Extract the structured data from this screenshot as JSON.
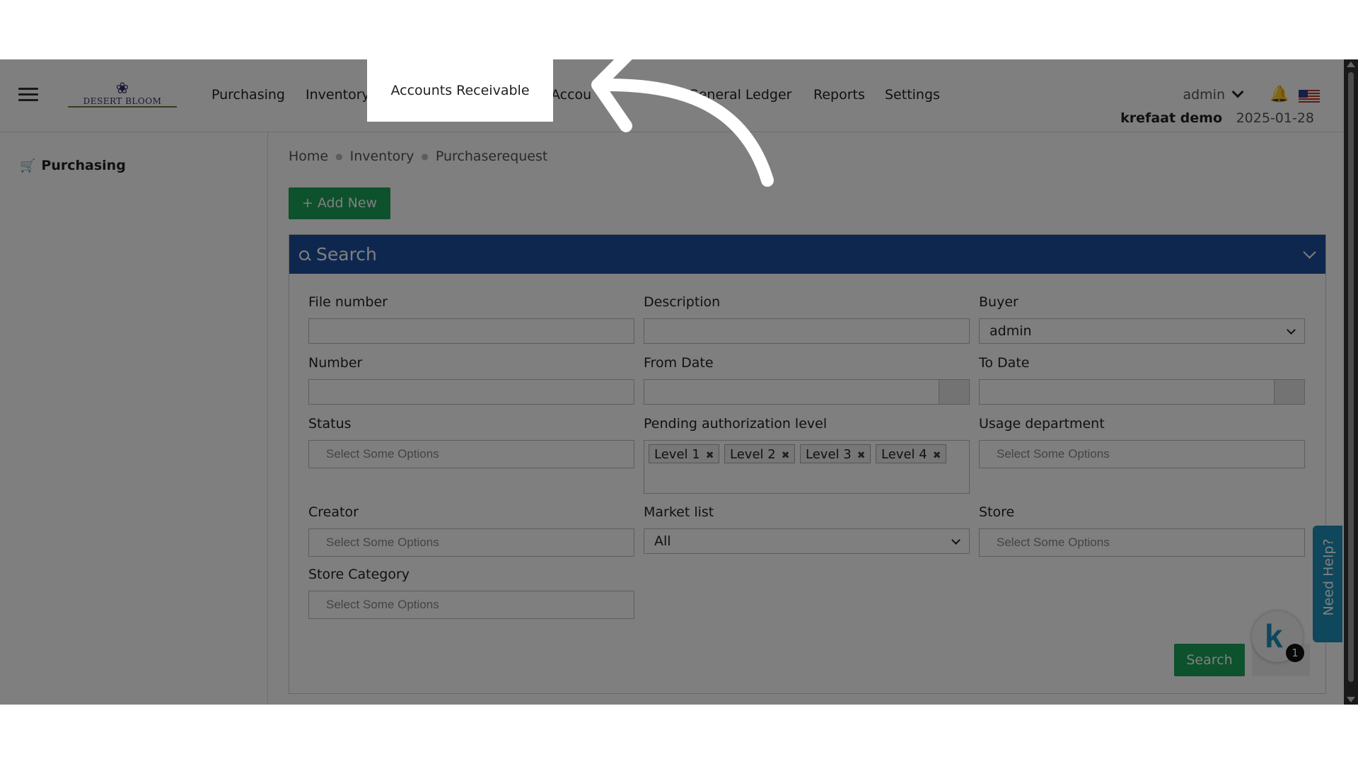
{
  "header": {
    "logo_text": "DESERT BLOOM",
    "nav": [
      "Purchasing",
      "Inventory",
      "Accounts Receivable",
      "Accou",
      "General Ledger",
      "Reports",
      "Settings"
    ],
    "user": "admin",
    "company": "krefaat demo",
    "date": "2025-01-28"
  },
  "sidebar": {
    "items": [
      {
        "label": "Purchasing",
        "icon": "cart-icon"
      }
    ]
  },
  "breadcrumb": [
    "Home",
    "Inventory",
    "Purchaserequest"
  ],
  "add_new_label": "+ Add New",
  "search_panel": {
    "title": "Search",
    "fields": {
      "file_number": {
        "label": "File number",
        "value": ""
      },
      "description": {
        "label": "Description",
        "value": ""
      },
      "buyer": {
        "label": "Buyer",
        "value": "admin"
      },
      "number": {
        "label": "Number",
        "value": ""
      },
      "from_date": {
        "label": "From Date",
        "value": ""
      },
      "to_date": {
        "label": "To Date",
        "value": ""
      },
      "status": {
        "label": "Status",
        "placeholder": "Select Some Options"
      },
      "pending_level": {
        "label": "Pending authorization level",
        "tags": [
          "Level 1",
          "Level 2",
          "Level 3",
          "Level 4"
        ]
      },
      "usage_department": {
        "label": "Usage department",
        "placeholder": "Select Some Options"
      },
      "creator": {
        "label": "Creator",
        "placeholder": "Select Some Options"
      },
      "market_list": {
        "label": "Market list",
        "value": "All"
      },
      "store": {
        "label": "Store",
        "placeholder": "Select Some Options"
      },
      "store_category": {
        "label": "Store Category",
        "placeholder": "Select Some Options"
      }
    },
    "search_button": "Search"
  },
  "help": {
    "label": "Need Help?",
    "badge_count": "1",
    "badge_letter": "k"
  },
  "colors": {
    "green": "#1aa35a",
    "panel_blue": "#1d4e9e",
    "help_blue": "#1e8fb8"
  }
}
